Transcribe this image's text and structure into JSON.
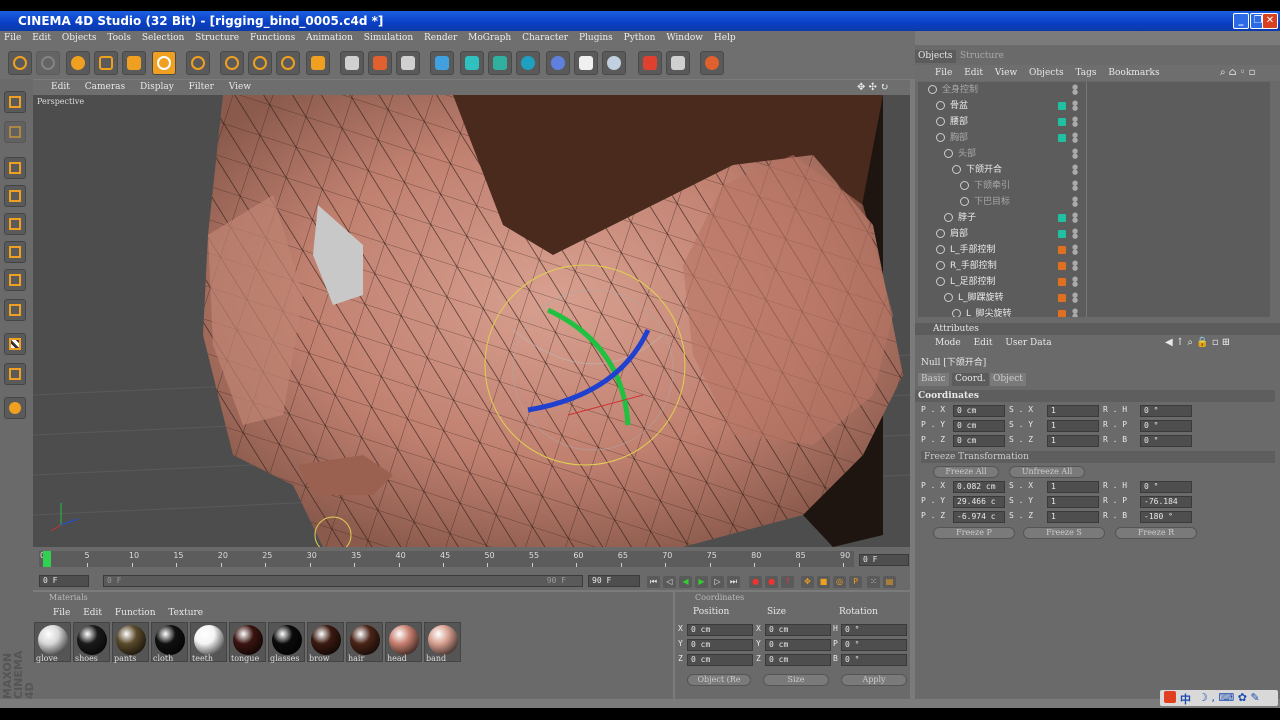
{
  "window": {
    "title": "CINEMA 4D Studio (32 Bit) - [rigging_bind_0005.c4d *]",
    "controls": [
      "_",
      "❐",
      "✕"
    ]
  },
  "menubar": [
    "File",
    "Edit",
    "Objects",
    "Tools",
    "Selection",
    "Structure",
    "Functions",
    "Animation",
    "Simulation",
    "Render",
    "MoGraph",
    "Character",
    "Plugins",
    "Python",
    "Window",
    "Help"
  ],
  "viewport": {
    "menu": [
      "Edit",
      "Cameras",
      "Display",
      "Filter",
      "View"
    ],
    "label": "Perspective"
  },
  "timeline": {
    "ticks": [
      "0",
      "5",
      "10",
      "15",
      "20",
      "25",
      "30",
      "35",
      "40",
      "45",
      "50",
      "55",
      "60",
      "65",
      "70",
      "75",
      "80",
      "85",
      "90"
    ],
    "current_frame": "0 F",
    "start_field": "0 F",
    "min_field": "0 F",
    "max_field": "90 F",
    "end_field": "90 F",
    "progress_value": 0
  },
  "materials": {
    "title": "Materials",
    "menu": [
      "File",
      "Edit",
      "Function",
      "Texture"
    ],
    "items": [
      {
        "name": "glove",
        "color": "#d8d8d8"
      },
      {
        "name": "shoes",
        "color": "#1a1a1a"
      },
      {
        "name": "pants",
        "color": "#5a4a2a"
      },
      {
        "name": "cloth",
        "color": "#101010"
      },
      {
        "name": "teeth",
        "color": "#f4f4f4"
      },
      {
        "name": "tongue",
        "color": "#3a1410"
      },
      {
        "name": "glasses",
        "color": "#0a0a0a"
      },
      {
        "name": "brow",
        "color": "#3a1a10"
      },
      {
        "name": "hair",
        "color": "#4a2418"
      },
      {
        "name": "head",
        "color": "#c88070"
      },
      {
        "name": "band",
        "color": "#d8a090"
      }
    ]
  },
  "coordinates_panel": {
    "title": "Coordinates",
    "headers": [
      "Position",
      "Size",
      "Rotation"
    ],
    "rows": [
      {
        "axis": "X",
        "pos": "0 cm",
        "size": "0 cm",
        "rot_label": "H",
        "rot": "0 °"
      },
      {
        "axis": "Y",
        "pos": "0 cm",
        "size": "0 cm",
        "rot_label": "P",
        "rot": "0 °"
      },
      {
        "axis": "Z",
        "pos": "0 cm",
        "size": "0 cm",
        "rot_label": "B",
        "rot": "0 °"
      }
    ],
    "mode_select": "Object (Re",
    "size_select": "Size",
    "apply": "Apply"
  },
  "objects": {
    "tabs": [
      "Objects",
      "Structure"
    ],
    "menu": [
      "File",
      "Edit",
      "View",
      "Objects",
      "Tags",
      "Bookmarks"
    ],
    "rows": [
      {
        "name": "全身控制",
        "indent": 0,
        "dim": true,
        "dot": "none"
      },
      {
        "name": "骨盆",
        "indent": 1,
        "dim": false,
        "dot": "#20c0a0"
      },
      {
        "name": "腰部",
        "indent": 1,
        "dim": false,
        "dot": "#20c0a0"
      },
      {
        "name": "胸部",
        "indent": 1,
        "dim": true,
        "dot": "#20c0a0"
      },
      {
        "name": "头部",
        "indent": 2,
        "dim": true,
        "dot": "none"
      },
      {
        "name": "下颌开合",
        "indent": 3,
        "dim": false,
        "dot": "none"
      },
      {
        "name": "下颌牵引",
        "indent": 4,
        "dim": true,
        "dot": "none"
      },
      {
        "name": "下巴目标",
        "indent": 4,
        "dim": true,
        "dot": "none"
      },
      {
        "name": "脖子",
        "indent": 2,
        "dim": false,
        "dot": "#20c0a0"
      },
      {
        "name": "肩部",
        "indent": 1,
        "dim": false,
        "dot": "#20c0a0"
      },
      {
        "name": "L_手部控制",
        "indent": 1,
        "dim": false,
        "dot": "#e07020"
      },
      {
        "name": "R_手部控制",
        "indent": 1,
        "dim": false,
        "dot": "#e07020"
      },
      {
        "name": "L_足部控制",
        "indent": 1,
        "dim": false,
        "dot": "#e07020"
      },
      {
        "name": "L_脚踝旋转",
        "indent": 2,
        "dim": false,
        "dot": "#e07020"
      },
      {
        "name": "L_脚尖旋转",
        "indent": 3,
        "dim": false,
        "dot": "#e07020"
      }
    ]
  },
  "attributes": {
    "title": "Attributes",
    "menu": [
      "Mode",
      "Edit",
      "User Data"
    ],
    "object_label": "Null [下颌开合]",
    "tabs": [
      "Basic",
      "Coord.",
      "Object"
    ],
    "section": "Coordinates",
    "rows": [
      {
        "p": "P . X",
        "pv": "0 cm",
        "s": "S . X",
        "sv": "1",
        "r": "R . H",
        "rv": "0 °"
      },
      {
        "p": "P . Y",
        "pv": "0 cm",
        "s": "S . Y",
        "sv": "1",
        "r": "R . P",
        "rv": "0 °"
      },
      {
        "p": "P . Z",
        "pv": "0 cm",
        "s": "S . Z",
        "sv": "1",
        "r": "R . B",
        "rv": "0 °"
      }
    ],
    "freeze_section": "Freeze Transformation",
    "freeze_all": "Freeze All",
    "unfreeze_all": "Unfreeze All",
    "frows": [
      {
        "p": "P . X",
        "pv": "0.082 cm",
        "s": "S . X",
        "sv": "1",
        "r": "R . H",
        "rv": "0 °"
      },
      {
        "p": "P . Y",
        "pv": "29.466 c",
        "s": "S . Y",
        "sv": "1",
        "r": "R . P",
        "rv": "-76.184"
      },
      {
        "p": "P . Z",
        "pv": "-6.974 c",
        "s": "S . Z",
        "sv": "1",
        "r": "R . B",
        "rv": "-180 °"
      }
    ],
    "freeze_p": "Freeze P",
    "freeze_s": "Freeze S",
    "freeze_r": "Freeze R"
  },
  "brand": "MAXON CINEMA 4D",
  "tray": {
    "label": "中"
  }
}
